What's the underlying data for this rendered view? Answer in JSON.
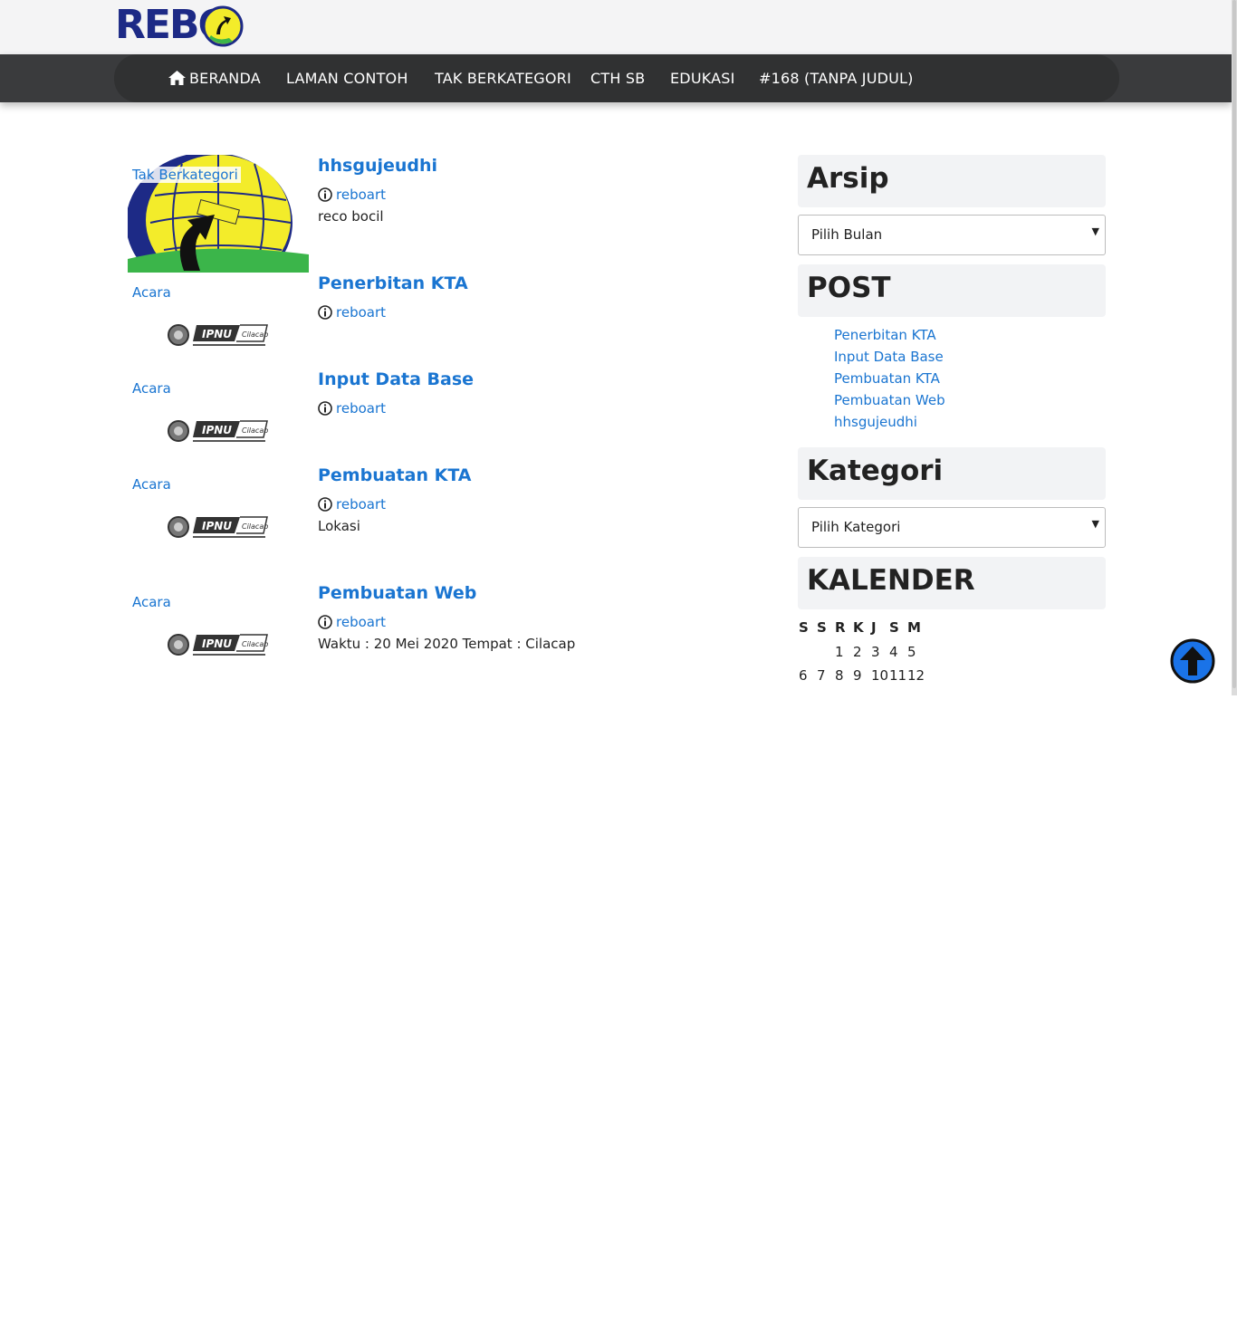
{
  "site": {
    "logo_text": "REBO"
  },
  "nav": {
    "items": [
      {
        "label": "BERANDA"
      },
      {
        "label": "LAMAN CONTOH"
      },
      {
        "label": "TAK BERKATEGORI"
      },
      {
        "label": "CTH SB"
      },
      {
        "label": "EDUKASI"
      },
      {
        "label": "#168 (TANPA JUDUL)"
      }
    ]
  },
  "posts": [
    {
      "category": "Tak Berkategori",
      "title": "hhsgujeudhi",
      "author": "reboart",
      "excerpt": "reco bocil"
    },
    {
      "category": "Acara",
      "title": "Penerbitan KTA",
      "author": "reboart",
      "excerpt": ""
    },
    {
      "category": "Acara",
      "title": "Input Data Base",
      "author": "reboart",
      "excerpt": ""
    },
    {
      "category": "Acara",
      "title": "Pembuatan KTA",
      "author": "reboart",
      "excerpt": "Lokasi"
    },
    {
      "category": "Acara",
      "title": "Pembuatan Web",
      "author": "reboart",
      "excerpt": "Waktu : 20 Mei 2020 Tempat : Cilacap"
    }
  ],
  "sidebar": {
    "archive": {
      "title": "Arsip",
      "select_value": "Pilih Bulan"
    },
    "recent": {
      "title": "POST",
      "items": [
        "Penerbitan KTA",
        "Input Data Base",
        "Pembuatan KTA",
        "Pembuatan Web",
        "hhsgujeudhi"
      ]
    },
    "categories": {
      "title": "Kategori",
      "select_value": "Pilih Kategori"
    },
    "calendar": {
      "title": "KALENDER",
      "day_headers": [
        "S",
        "S",
        "R",
        "K",
        "J",
        "S",
        "M"
      ],
      "week1": [
        "1",
        "2",
        "3",
        "4",
        "5"
      ],
      "week2": [
        "6",
        "7",
        "8",
        "9",
        "10",
        "11",
        "12"
      ]
    }
  },
  "icons": {
    "home": "home-icon",
    "author": "info-circle-icon",
    "back_to_top": "arrow-up-circle-icon"
  },
  "colors": {
    "link": "#1a75d1",
    "navbar": "#303132",
    "back_to_top": "#1a73e8"
  }
}
